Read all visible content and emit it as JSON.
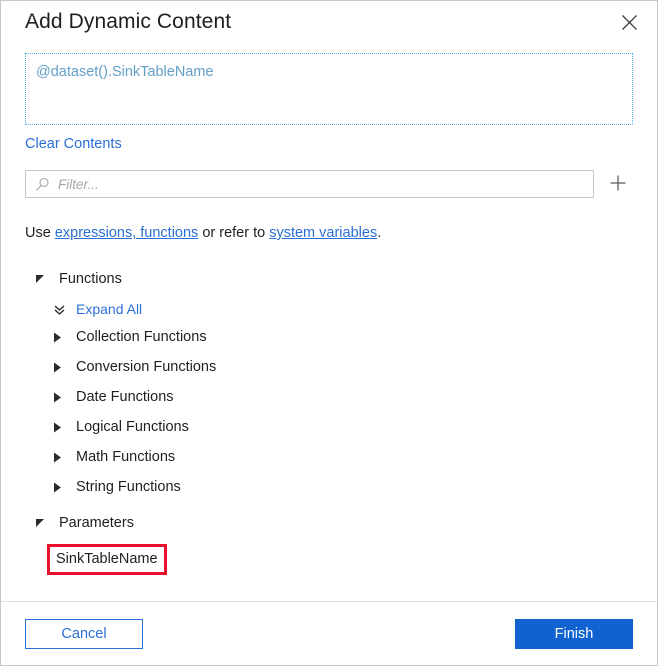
{
  "dialog": {
    "title": "Add Dynamic Content",
    "close_icon": "close-icon"
  },
  "expression": {
    "value": "@dataset().SinkTableName",
    "clear_label": "Clear Contents"
  },
  "filter": {
    "placeholder": "Filter...",
    "value": "",
    "search_icon": "search-icon",
    "add_icon": "plus-icon"
  },
  "help": {
    "prefix": "Use ",
    "link1": "expressions, functions",
    "middle": " or refer to ",
    "link2": "system variables",
    "suffix": "."
  },
  "tree": {
    "functions_group": {
      "label": "Functions",
      "expanded": true,
      "expand_all_label": "Expand All",
      "items": [
        {
          "label": "Collection Functions"
        },
        {
          "label": "Conversion Functions"
        },
        {
          "label": "Date Functions"
        },
        {
          "label": "Logical Functions"
        },
        {
          "label": "Math Functions"
        },
        {
          "label": "String Functions"
        }
      ]
    },
    "parameters_group": {
      "label": "Parameters",
      "expanded": true,
      "items": [
        {
          "label": "SinkTableName",
          "highlighted": true
        }
      ]
    }
  },
  "footer": {
    "cancel_label": "Cancel",
    "finish_label": "Finish"
  },
  "colors": {
    "accent_blue": "#2a6fd6",
    "primary_button": "#0f62d0",
    "expression_text": "#62a0c8",
    "expression_border": "#4fb3e8",
    "highlight_red": "#e8112d",
    "dialog_border": "#c8c8c8"
  }
}
